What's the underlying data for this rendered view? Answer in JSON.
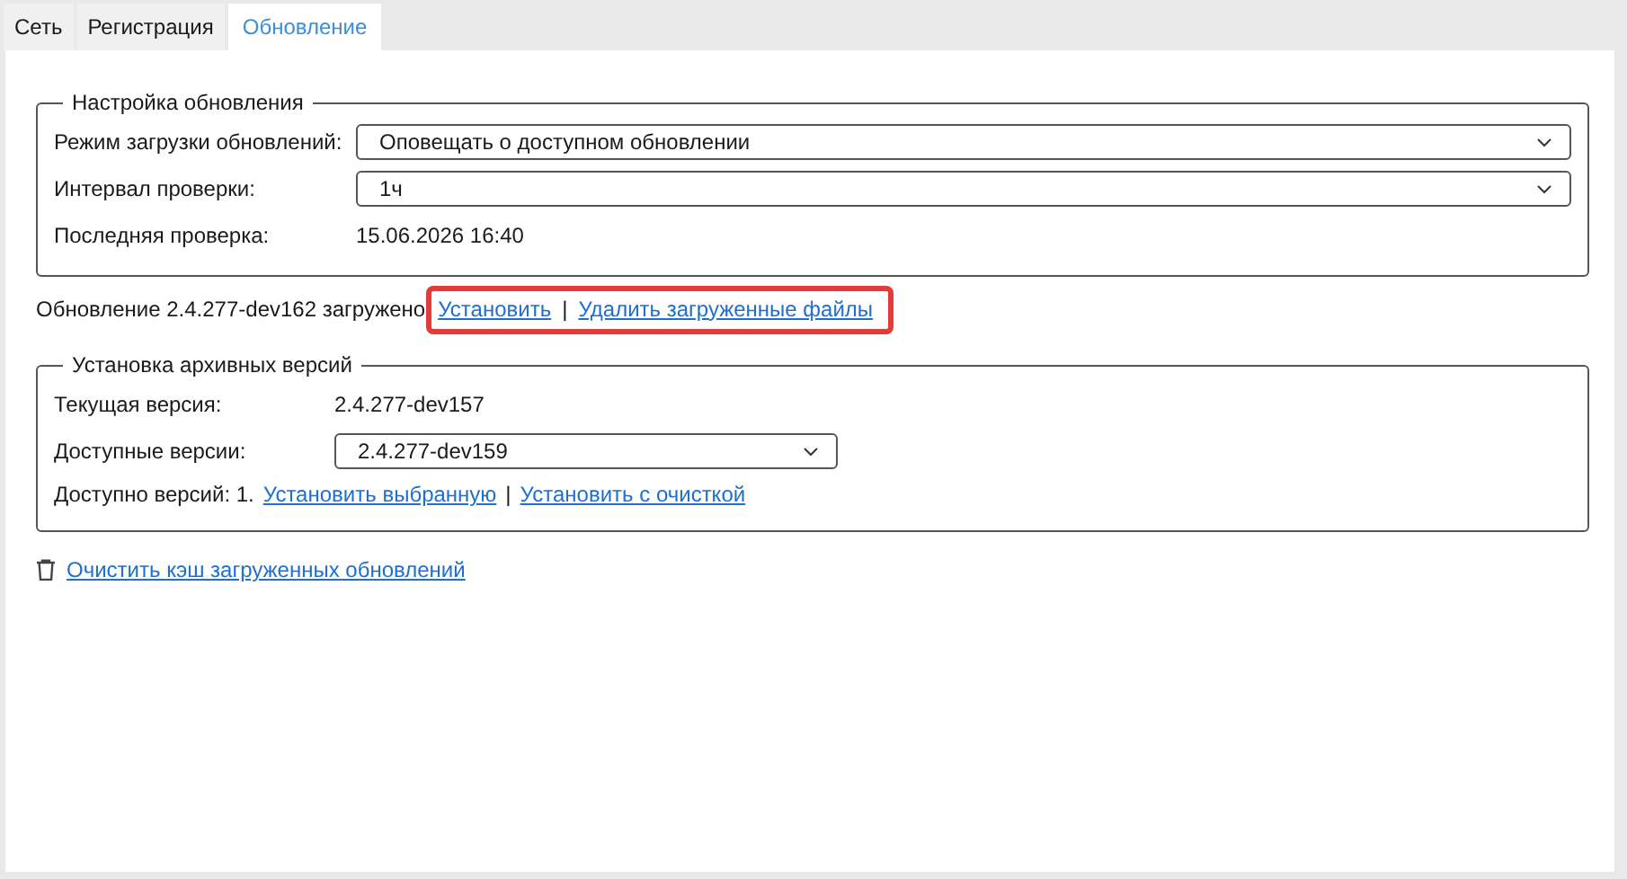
{
  "tabs": [
    {
      "label": "Сеть",
      "selected": false
    },
    {
      "label": "Регистрация",
      "selected": false
    },
    {
      "label": "Обновление",
      "selected": true
    }
  ],
  "update_settings": {
    "title": "Настройка обновления",
    "rows": [
      {
        "kind": "dropdown",
        "label": "Режим загрузки обновлений:",
        "value": "Оповещать о доступном обновлении"
      },
      {
        "kind": "dropdown",
        "label": "Интервал проверки:",
        "value": "1ч"
      },
      {
        "kind": "text",
        "label": "Последняя проверка:",
        "value": "15.06.2026  16:40"
      }
    ]
  },
  "download_status": {
    "text": "Обновление 2.4.277-dev162 загружено",
    "links": [
      "Установить",
      "Удалить загруженные файлы"
    ],
    "separator": "|",
    "highlighted": true
  },
  "archive": {
    "title": "Установка архивных версий",
    "rows": [
      {
        "kind": "text",
        "label": "Текущая версия:",
        "value": "2.4.277-dev157"
      },
      {
        "kind": "dropdown",
        "label": "Доступные версии:",
        "value": "2.4.277-dev159"
      }
    ],
    "count_text": "Доступно версий: 1.",
    "links": [
      "Установить выбранную",
      "Установить с очисткой"
    ],
    "separator": "|"
  },
  "clear_cache_link": "Очистить кэш загруженных обновлений"
}
